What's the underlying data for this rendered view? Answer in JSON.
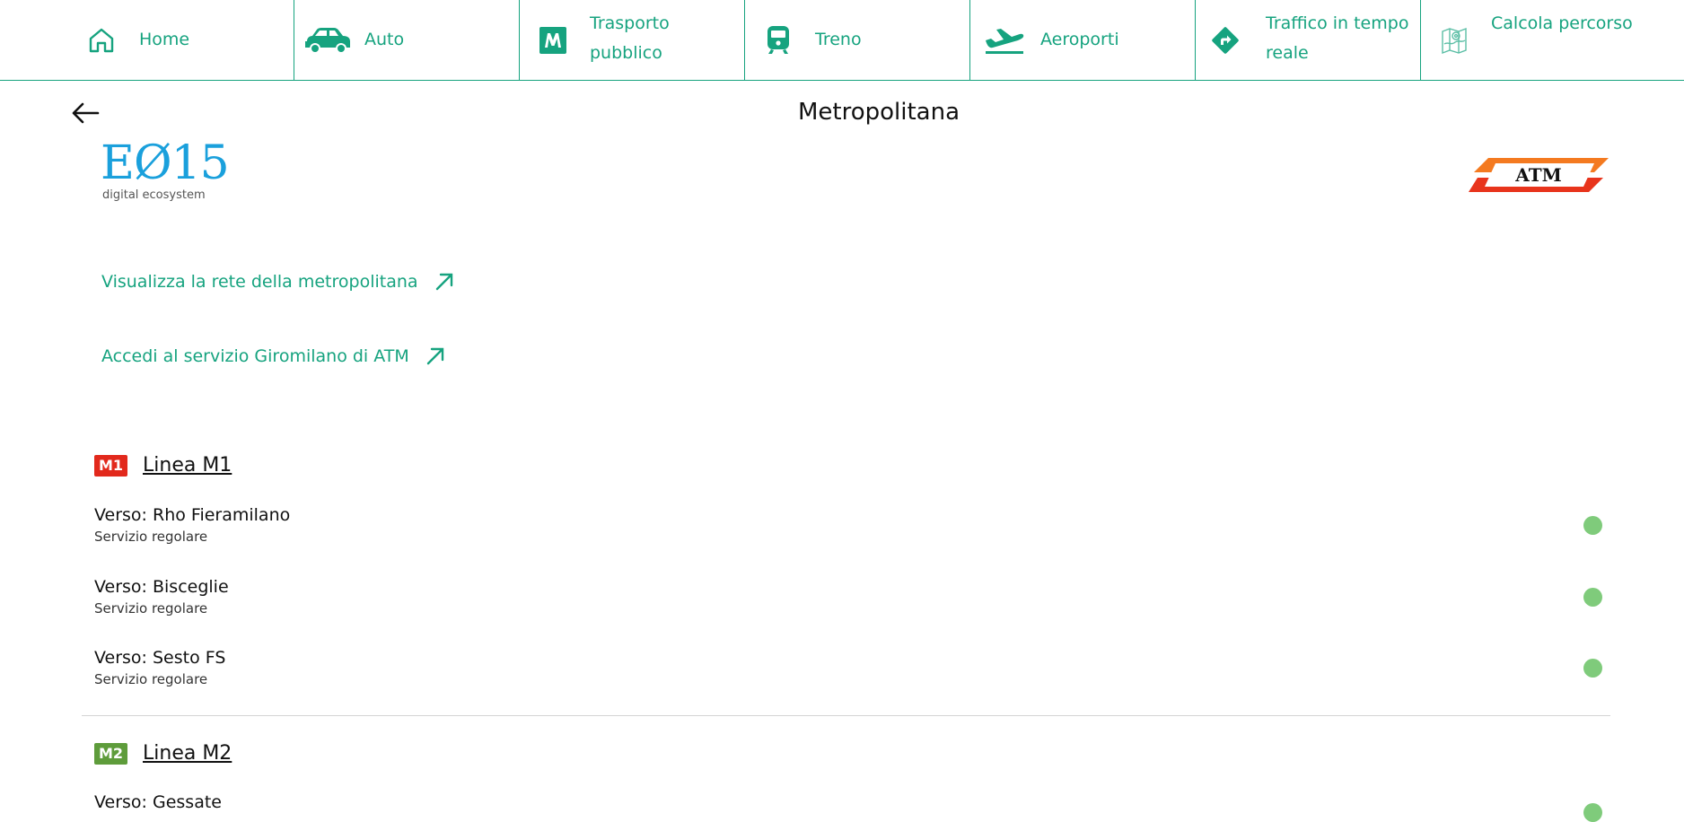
{
  "nav": {
    "items": [
      {
        "label": "Home",
        "icon": "home-icon"
      },
      {
        "label": "Auto",
        "icon": "car-icon"
      },
      {
        "label": "Trasporto pubblico",
        "icon": "metro-icon"
      },
      {
        "label": "Treno",
        "icon": "train-icon"
      },
      {
        "label": "Aeroporti",
        "icon": "plane-icon"
      },
      {
        "label": "Traffico in tempo reale",
        "icon": "directions-icon"
      },
      {
        "label": "Calcola percorso",
        "icon": "map-icon"
      }
    ]
  },
  "header": {
    "title": "Metropolitana"
  },
  "logos": {
    "e015_main": "EØ15",
    "e015_sub": "digital ecosystem",
    "atm": "ATM"
  },
  "links": [
    {
      "label": "Visualizza la rete della metropolitana"
    },
    {
      "label": "Accedi al servizio Giromilano di ATM"
    }
  ],
  "lines": [
    {
      "badge": "M1",
      "badge_color": "#e2291c",
      "title": "Linea M1",
      "directions": [
        {
          "name": "Verso: Rho Fieramilano",
          "status": "Servizio regolare",
          "status_color": "#7fcb7b"
        },
        {
          "name": "Verso: Bisceglie",
          "status": "Servizio regolare",
          "status_color": "#7fcb7b"
        },
        {
          "name": "Verso: Sesto FS",
          "status": "Servizio regolare",
          "status_color": "#7fcb7b"
        }
      ]
    },
    {
      "badge": "M2",
      "badge_color": "#5e9c3b",
      "title": "Linea M2",
      "directions": [
        {
          "name": "Verso: Gessate",
          "status": "",
          "status_color": "#7fcb7b"
        }
      ]
    }
  ],
  "colors": {
    "accent": "#16a37f",
    "divider": "#d4d4d4"
  }
}
